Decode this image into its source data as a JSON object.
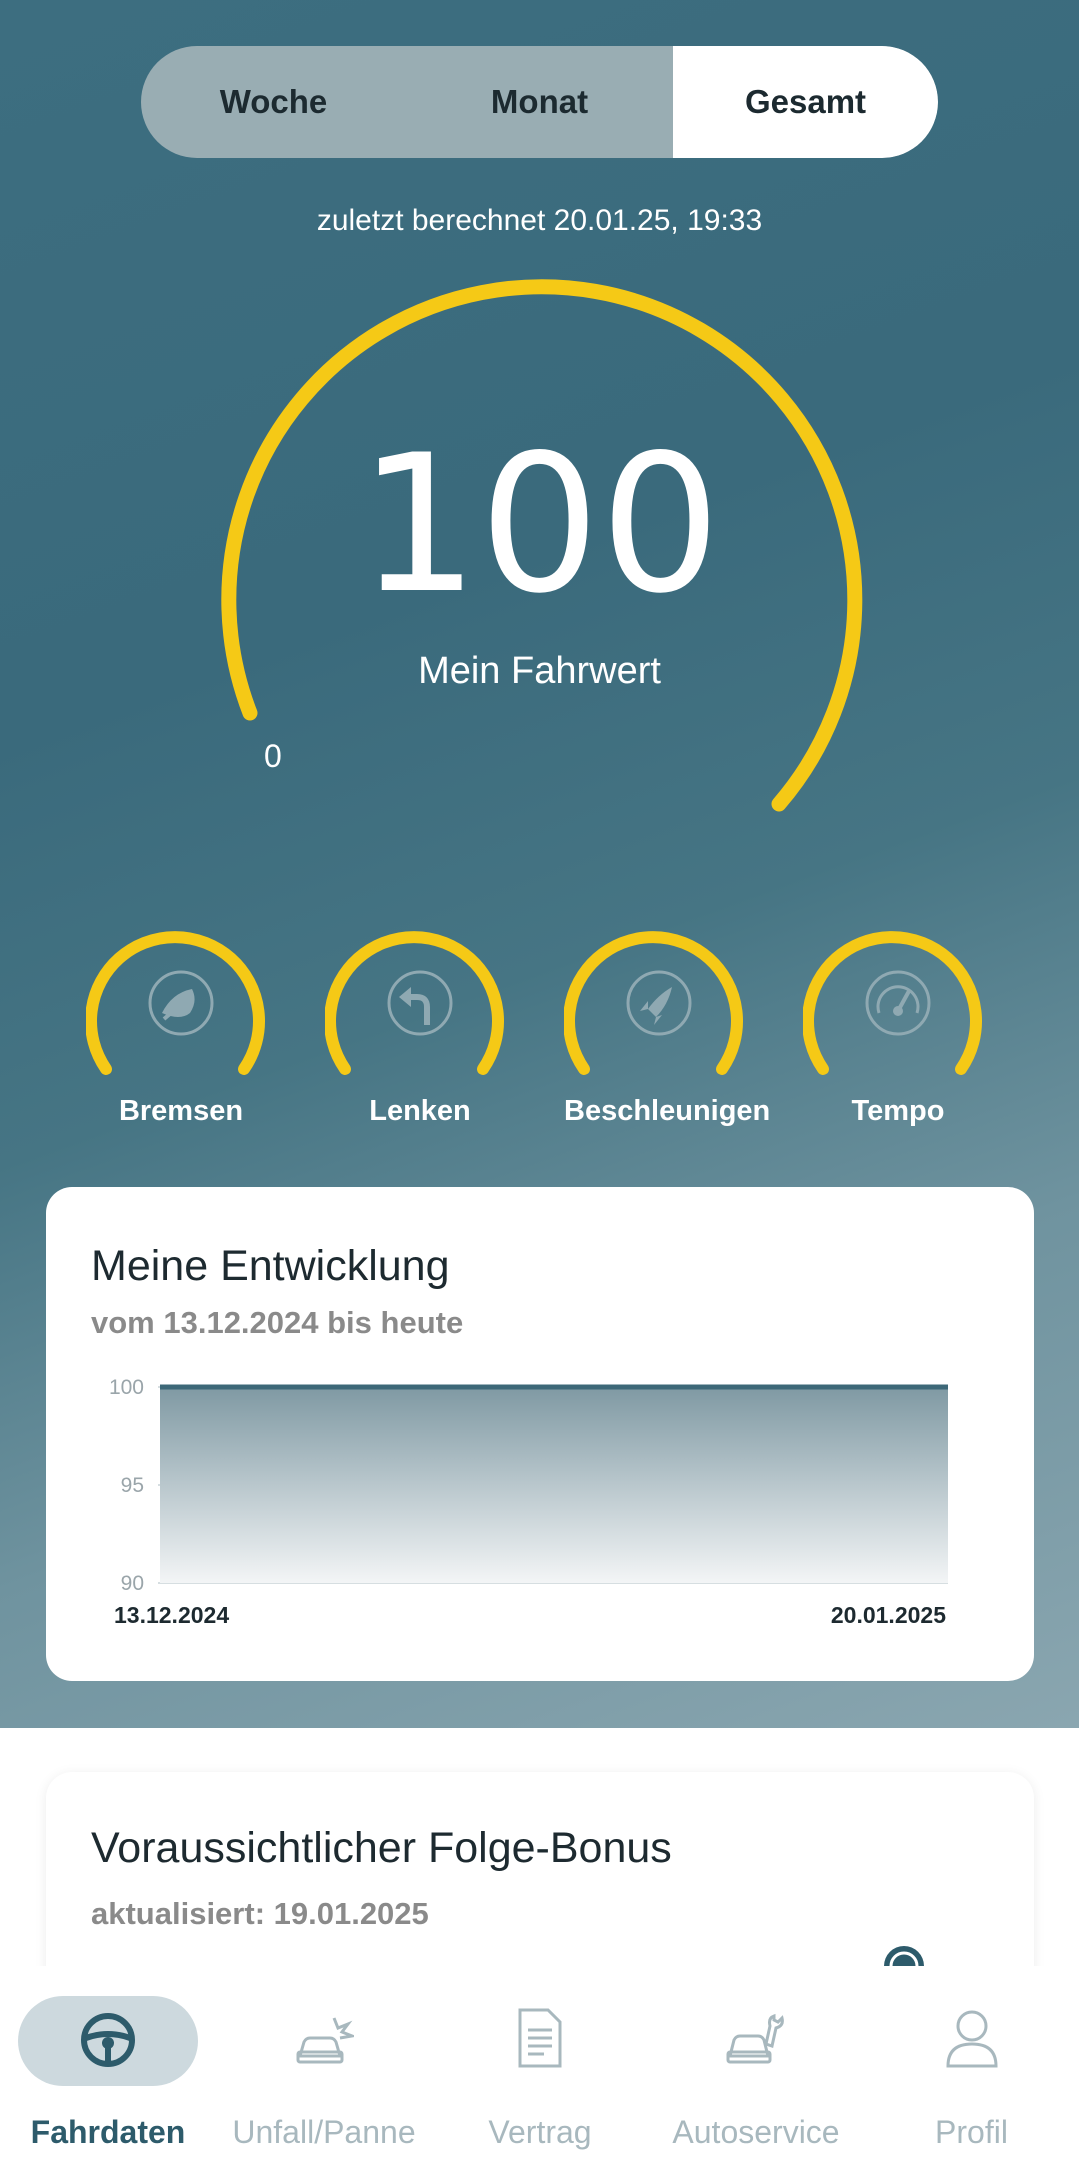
{
  "tabs": {
    "options": [
      "Woche",
      "Monat",
      "Gesamt"
    ],
    "selected": "Gesamt"
  },
  "last_calculated": "zuletzt berechnet 20.01.25, 19:33",
  "score": {
    "value": "100",
    "label": "Mein Fahrwert",
    "min_label": "0",
    "fraction": 1.0
  },
  "categories": [
    {
      "label": "Bremsen",
      "icon": "brake-icon"
    },
    {
      "label": "Lenken",
      "icon": "steering-turn-icon"
    },
    {
      "label": "Beschleunigen",
      "icon": "rocket-icon"
    },
    {
      "label": "Tempo",
      "icon": "speedometer-icon"
    }
  ],
  "development": {
    "title": "Meine Entwicklung",
    "subtitle": "vom 13.12.2024 bis heute"
  },
  "chart_data": {
    "type": "area",
    "x": [
      "13.12.2024",
      "20.01.2025"
    ],
    "values": [
      100,
      100
    ],
    "y_ticks": [
      "100",
      "95",
      "90"
    ],
    "ylim": [
      90,
      100
    ],
    "grid": true,
    "colors": {
      "line": "#3d6878"
    }
  },
  "bonus": {
    "title": "Voraussichtlicher Folge-Bonus",
    "subtitle": "aktualisiert: 19.01.2025"
  },
  "nav": {
    "items": [
      {
        "label": "Fahrdaten",
        "icon": "steering-wheel-icon",
        "active": true
      },
      {
        "label": "Unfall/Panne",
        "icon": "car-crash-icon",
        "active": false
      },
      {
        "label": "Vertrag",
        "icon": "document-icon",
        "active": false
      },
      {
        "label": "Autoservice",
        "icon": "car-service-icon",
        "active": false
      },
      {
        "label": "Profil",
        "icon": "person-icon",
        "active": false
      }
    ]
  },
  "colors": {
    "accent": "#f5c916",
    "primary": "#2d5b6b"
  }
}
